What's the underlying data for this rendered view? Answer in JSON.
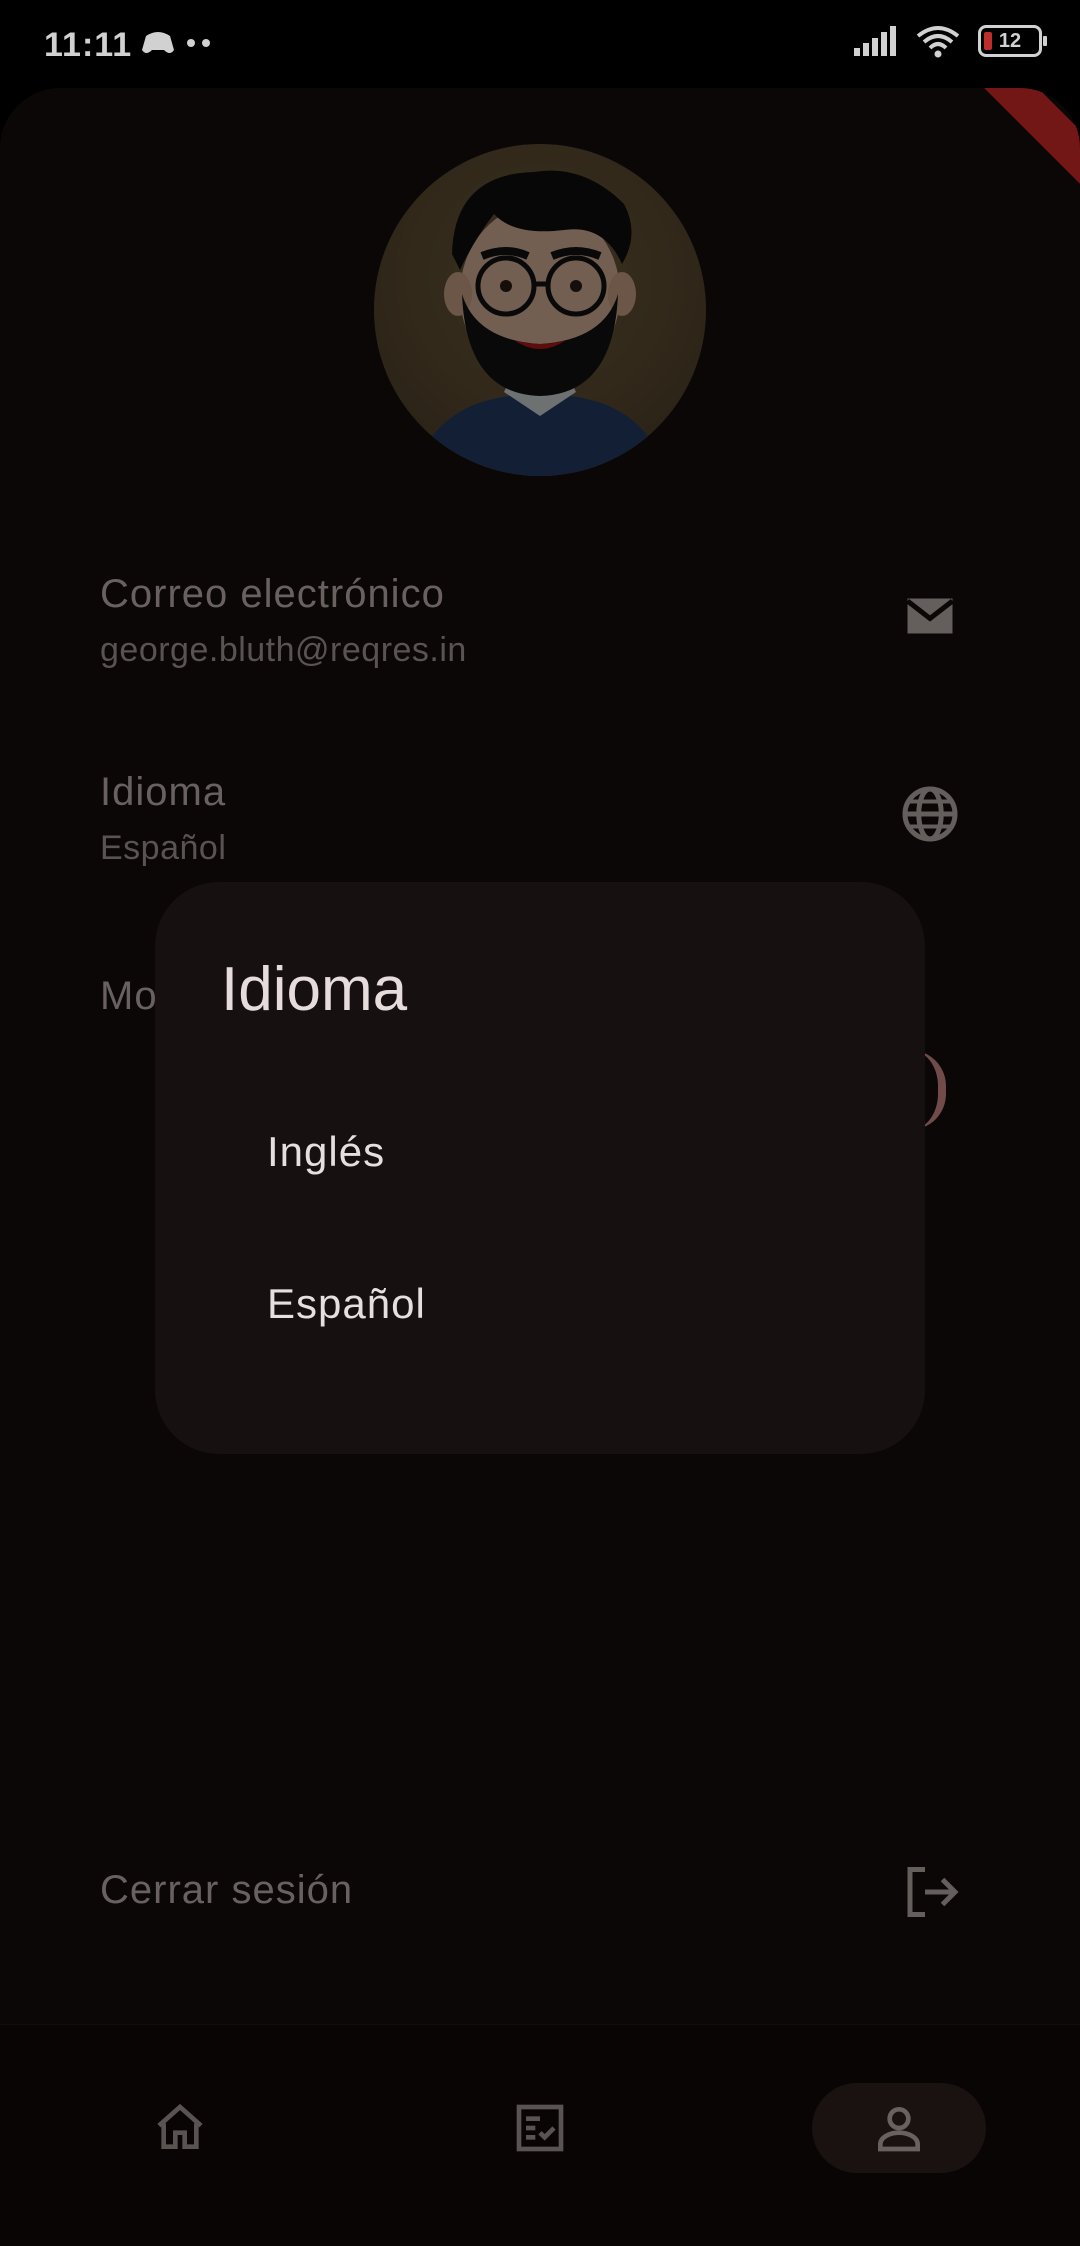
{
  "status_bar": {
    "time": "11:11",
    "battery_level": "12",
    "icons": [
      "game-icon",
      "dots-icon",
      "signal-icon",
      "wifi-icon",
      "battery-icon"
    ]
  },
  "profile": {
    "email_label": "Correo electrónico",
    "email_value": "george.bluth@reqres.in",
    "language_label": "Idioma",
    "language_value": "Español",
    "mode_label_partial": "Mo",
    "logout_label": "Cerrar sesión"
  },
  "dialog": {
    "title": "Idioma",
    "options": [
      "Inglés",
      "Español"
    ]
  },
  "nav": {
    "items": [
      {
        "icon": "home-icon"
      },
      {
        "icon": "checklist-icon"
      },
      {
        "icon": "profile-icon"
      }
    ],
    "active_index": 2
  },
  "colors": {
    "background": "#0d0908",
    "dialog": "#161011",
    "accent": "#8a5b5b"
  }
}
